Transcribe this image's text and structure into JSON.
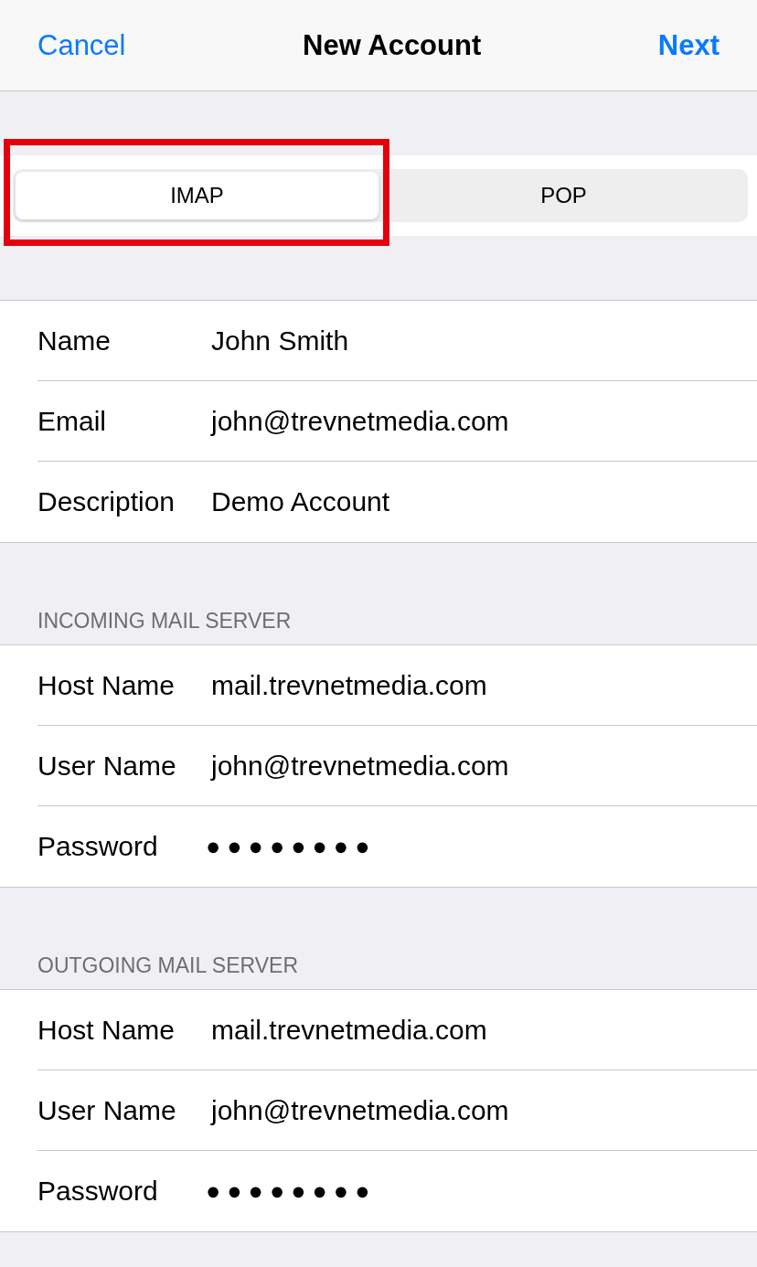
{
  "nav": {
    "cancel": "Cancel",
    "title": "New Account",
    "next": "Next"
  },
  "segments": [
    {
      "label": "IMAP",
      "selected": true,
      "highlighted": true
    },
    {
      "label": "POP",
      "selected": false,
      "highlighted": false
    }
  ],
  "sections": [
    {
      "rows": [
        {
          "label": "Name",
          "value": "John Smith",
          "kind": "text"
        },
        {
          "label": "Email",
          "value": "john@trevnetmedia.com",
          "kind": "text"
        },
        {
          "label": "Description",
          "value": "Demo Account",
          "kind": "text"
        }
      ]
    },
    {
      "header": "INCOMING MAIL SERVER",
      "rows": [
        {
          "label": "Host Name",
          "value": "mail.trevnetmedia.com",
          "kind": "text"
        },
        {
          "label": "User Name",
          "value": "john@trevnetmedia.com",
          "kind": "text"
        },
        {
          "label": "Password",
          "value": "●●●●●●●●",
          "kind": "password"
        }
      ]
    },
    {
      "header": "OUTGOING MAIL SERVER",
      "rows": [
        {
          "label": "Host Name",
          "value": "mail.trevnetmedia.com",
          "kind": "text"
        },
        {
          "label": "User Name",
          "value": "john@trevnetmedia.com",
          "kind": "text"
        },
        {
          "label": "Password",
          "value": "●●●●●●●●",
          "kind": "password"
        }
      ]
    }
  ]
}
